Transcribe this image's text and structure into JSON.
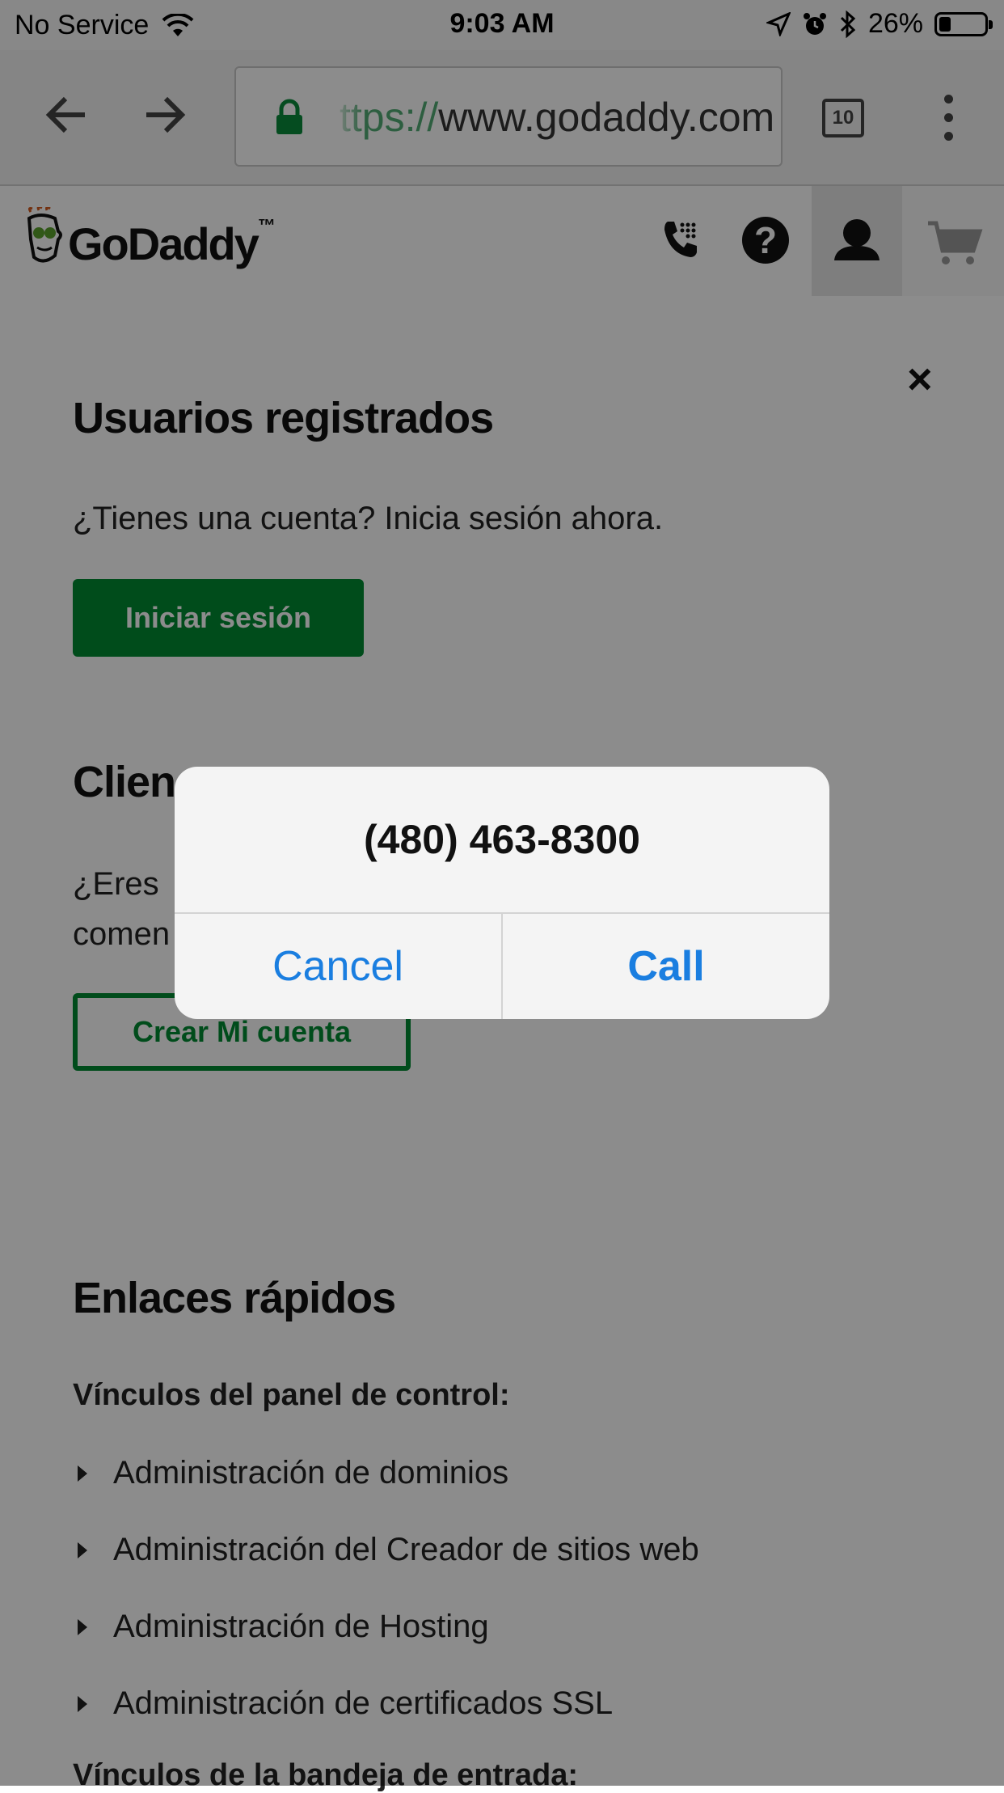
{
  "status_bar": {
    "carrier": "No Service",
    "time": "9:03 AM",
    "battery": "26%",
    "battery_level": 0.26
  },
  "browser": {
    "url_scheme": "ttps://",
    "url_host": "www.godaddy.com",
    "tab_count": "10"
  },
  "header": {
    "logo_text": "GoDaddy",
    "logo_tm": "™",
    "help_glyph": "?"
  },
  "content": {
    "close_glyph": "×",
    "registered": {
      "title": "Usuarios registrados",
      "text": "¿Tienes una cuenta? Inicia sesión ahora.",
      "button": "Iniciar sesión"
    },
    "new_customers": {
      "title": "Clien",
      "line1": "¿Eres",
      "line2": "comen",
      "button": "Crear Mi cuenta"
    },
    "quick_links": {
      "title": "Enlaces rápidos",
      "subtitle": "Vínculos del panel de control:",
      "items": [
        "Administración de dominios",
        "Administración del Creador de sitios web",
        "Administración de Hosting",
        "Administración de certificados SSL"
      ],
      "subtitle2": "Vínculos de la bandeja de entrada:"
    }
  },
  "alert": {
    "title": "(480) 463-8300",
    "cancel": "Cancel",
    "call": "Call"
  },
  "colors": {
    "brand_green": "#008a32",
    "ios_blue": "#1a7ee0"
  }
}
